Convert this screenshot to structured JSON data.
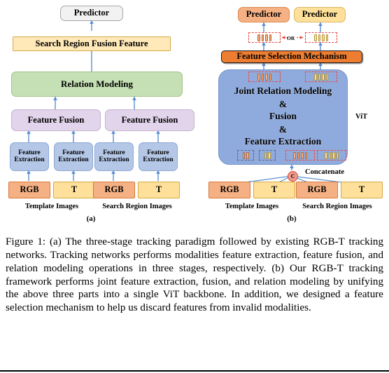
{
  "figure": {
    "label_a": "(a)",
    "label_b": "(b)",
    "caption": "Figure 1: (a) The three-stage tracking paradigm followed by existing RGB-T tracking networks. Tracking networks performs modalities feature extraction, feature fusion, and relation modeling operations in three stages, respectively. (b) Our RGB-T tracking framework performs joint feature extraction, fusion, and relation modeling by unifying the above three parts into a single ViT backbone. In addition, we designed a feature selection mechanism to help us discard features from invalid modalities."
  },
  "panel_a": {
    "predictor": "Predictor",
    "search_region_fusion_feature": "Search Region Fusion Feature",
    "relation_modeling": "Relation Modeling",
    "feature_fusion_left": "Feature Fusion",
    "feature_fusion_right": "Feature Fusion",
    "feature_extraction": [
      "Feature Extraction",
      "Feature Extraction",
      "Feature Extraction",
      "Feature Extraction"
    ],
    "extraction_line1": "Feature",
    "extraction_line2": "Extraction",
    "modalities": [
      "RGB",
      "T",
      "RGB",
      "T"
    ],
    "group_template": "Template Images",
    "group_search": "Search Region Images"
  },
  "panel_b": {
    "predictor_rgb": "Predictor",
    "predictor_t": "Predictor",
    "or_text": "OR",
    "feature_selection_mechanism": "Feature Selection Mechanism",
    "vit_line1": "Joint Relation Modeling",
    "vit_line2": "&",
    "vit_line3": "Fusion",
    "vit_line4": "&",
    "vit_line5": "Feature Extraction",
    "vit_label": "ViT",
    "concatenate": "Concatenate",
    "concat_symbol": "C",
    "modalities": [
      "RGB",
      "T",
      "RGB",
      "T"
    ],
    "group_template": "Template Images",
    "group_search": "Search Region Images",
    "token_groups": {
      "top_or_left": {
        "count": 4,
        "color": "orange",
        "border": "red"
      },
      "top_or_right": {
        "count": 4,
        "color": "yellow",
        "border": "red"
      },
      "mid_left": {
        "count": 4,
        "color": "orange",
        "border": "red"
      },
      "mid_right": {
        "count": 4,
        "color": "yellow",
        "border": "red"
      },
      "bottom_tmpl_rgb": {
        "count": 2,
        "color": "orange",
        "border": "slate"
      },
      "bottom_tmpl_t": {
        "count": 2,
        "color": "yellow",
        "border": "slate"
      },
      "bottom_search_rgb": {
        "count": 4,
        "color": "orange",
        "border": "red"
      },
      "bottom_search_t": {
        "count": 4,
        "color": "yellow",
        "border": "red"
      }
    }
  },
  "colors": {
    "arrow": "#5b8fd0",
    "predictor_gray": "#f2f2f2",
    "rgb_box": "#f5b183",
    "t_box": "#ffe09a",
    "relation_modeling": "#c5e0b4",
    "feature_fusion": "#e2d4ea",
    "feature_extraction": "#b4c7e7",
    "vit_body": "#8faadc",
    "feature_selection": "#ed7d31",
    "token_red_border": "#e8504a",
    "token_slate_border": "#5a6b84",
    "concat_circle": "#ef9a8a"
  }
}
